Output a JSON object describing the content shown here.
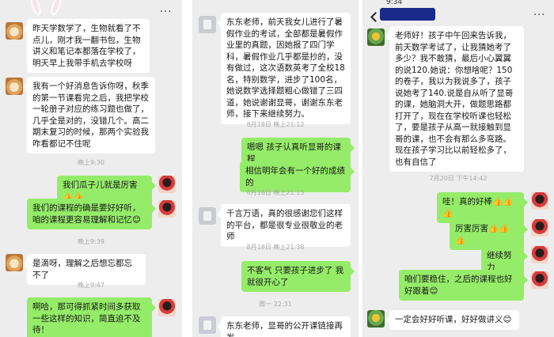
{
  "panel1": {
    "messages": [
      "昨天学数学了，生物就看了不点儿，刚才我一翻书包，生物讲义和笔记本都落在学校了，明天早上我带手机去学校呀",
      "我有一个好消息告诉你呀，秋季的第一节课看完之后，我把学校一轮册子对应的练习题也做了，几乎全是对的，没错几个。高二期末复习的时候，那两个实验我咋看都记不住呢",
      "我们瓜子儿就是厉害👍👍",
      "我们的课程的确是要好好听，咱的课程更容易理解和记忆😊",
      "是滴呀，理解之后想忘都忘不了",
      "啊哈，那可得抓紧时间多获取一些这样的知识，简直迫不及待！"
    ],
    "timestamps": [
      "晚上9:30",
      "晚上9:39",
      "晚上9:47"
    ]
  },
  "panel2": {
    "messages": [
      "东东老师，前天我女儿进行了暑假作业的考试，全部都是暑假作业里的真题，因她报了四门学科，暑假作业几乎都是抄的，没有做过，这次语数英考了全校18名，特别数学，进步了100名，她说数学选择题粗心做错了三四道，她说谢谢显哥，谢谢东东老师，接下来继续努力。",
      "嗯嗯  孩子认真听显哥的课程",
      "相信明年会有一个好的成绩的",
      "千言万语，真的很感谢您们这样的平台，都是很专业很敬业的老师",
      "不客气  只要孩子进步了  我就很开心了",
      "东东老师，显哥的公开课链接再发"
    ],
    "timestamps": [
      "8月18日 晚上21:12",
      "8月18日 晚上21:15",
      "8月18日 晚上21:38",
      "周一 22:31"
    ]
  },
  "panel3": {
    "messages": [
      "老师好！孩子中午回来告诉我，前天数学考试了，让我猜她考了多少？我不敢猜，最后小心翼翼的说120.她说：你想啥呢？150的卷子，我以为我说多了，孩子说她考了140.说是自从听了显哥的课，她脑洞大开，做题思路都打开了，现在在学校听课也轻松了，要是孩子从高一就接触到显哥的课，也不会有那么多弯路。现在孩子学习比以前轻松多了，也有自信了",
      "哇！真的好棒👍👍👍",
      "厉害厉害👍👍👍",
      "继续努力",
      "咱们要稳住，之后的课程也好好跟着😊",
      "一定会好好听课，好好做讲义😊"
    ],
    "timestamps": [
      "7月20日 下午14:42"
    ],
    "status_time": "9:34"
  },
  "icons": {
    "back": "chevron-left-icon",
    "more": "more-dots-icon"
  },
  "more_glyph": "···",
  "colors": {
    "chat_bg": "#ededed",
    "bubble_out": "#95ec69",
    "bubble_in": "#ffffff"
  }
}
